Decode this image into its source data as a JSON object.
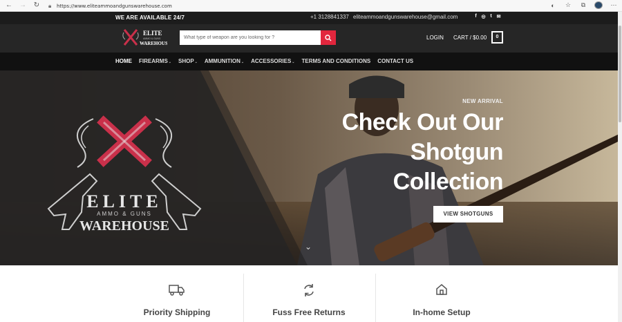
{
  "browser": {
    "url": "https://www.eliteammoandgunswarehouse.com",
    "icons": [
      "back-icon",
      "forward-icon",
      "reload-icon",
      "lock-icon",
      "tracking-icon",
      "favorites-icon",
      "collections-icon",
      "profile-icon",
      "more-icon"
    ]
  },
  "topbar": {
    "availability": "WE ARE AVAILABLE 24/7",
    "phone": "+1 3128841337",
    "email": "eliteammoandgunswarehouse@gmail.com",
    "social": [
      "f",
      "◎",
      "t",
      "✉"
    ]
  },
  "header": {
    "logo_text_top": "ELITE",
    "logo_text_middle": "AMMO & GUNS",
    "logo_text_bottom": "WAREHOUSE",
    "search_placeholder": "What type of weapon are you looking for ?",
    "login": "LOGIN",
    "cart": "CART / $0.00",
    "cart_count": "0"
  },
  "nav": {
    "items": [
      {
        "label": "HOME",
        "caret": ""
      },
      {
        "label": "FIREARMS",
        "caret": "⌄"
      },
      {
        "label": "SHOP",
        "caret": "⌄"
      },
      {
        "label": "AMMUNITION",
        "caret": "⌄"
      },
      {
        "label": "ACCESSORIES",
        "caret": "⌄"
      },
      {
        "label": "TERMS AND CONDITIONS",
        "caret": ""
      },
      {
        "label": "CONTACT US",
        "caret": ""
      }
    ]
  },
  "hero": {
    "eyebrow": "NEW ARRIVAL",
    "headline": "Check Out Our Shotgun Collection",
    "cta": "VIEW SHOTGUNS",
    "logo_elite": "ELITE",
    "logo_middle": "AMMO & GUNS",
    "logo_warehouse": "WAREHOUSE"
  },
  "features": [
    {
      "label": "Priority Shipping",
      "icon": "truck-icon"
    },
    {
      "label": "Fuss Free Returns",
      "icon": "returns-icon"
    },
    {
      "label": "In-home Setup",
      "icon": "home-icon"
    }
  ],
  "colors": {
    "accent": "#e2263d",
    "dark": "#262626",
    "nav": "#111111"
  }
}
